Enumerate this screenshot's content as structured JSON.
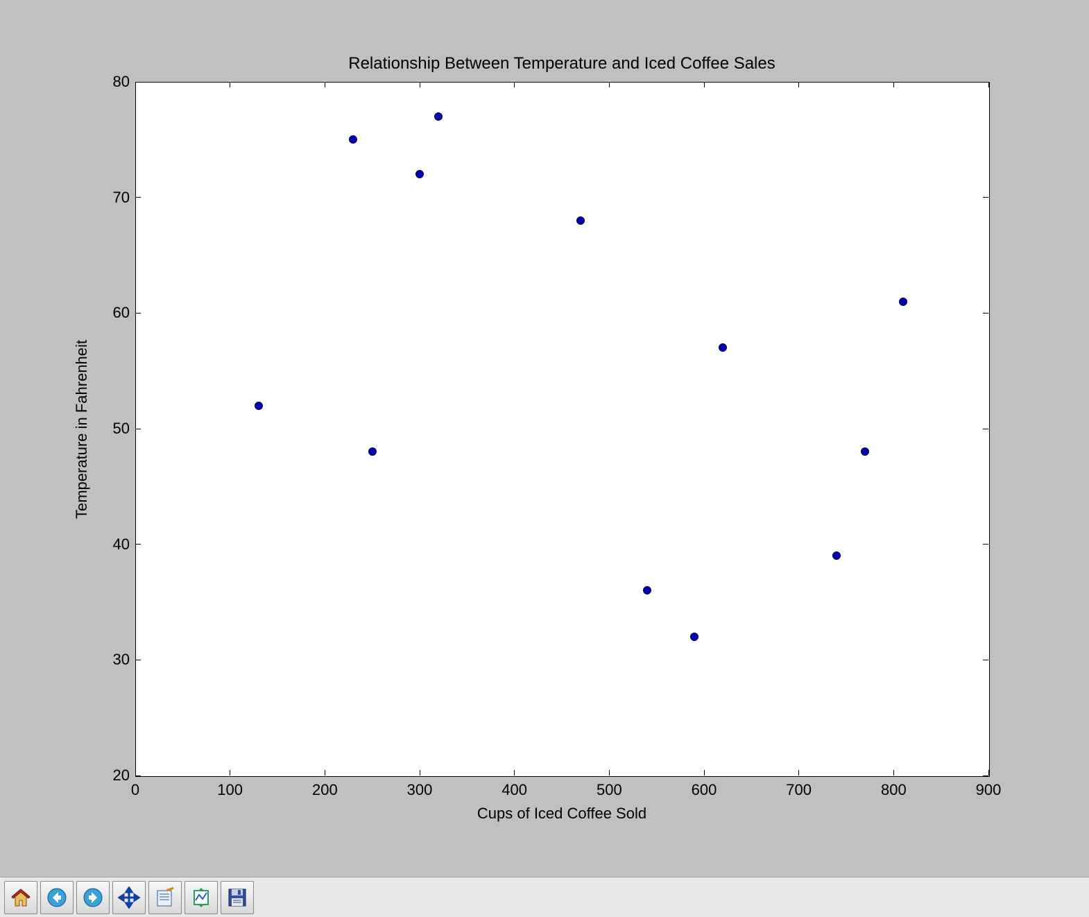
{
  "chart_data": {
    "type": "scatter",
    "title": "Relationship Between Temperature and Iced Coffee Sales",
    "xlabel": "Cups of Iced Coffee Sold",
    "ylabel": "Temperature in Fahrenheit",
    "xlim": [
      0,
      900
    ],
    "ylim": [
      20,
      80
    ],
    "xticks": [
      0,
      100,
      200,
      300,
      400,
      500,
      600,
      700,
      800,
      900
    ],
    "yticks": [
      20,
      30,
      40,
      50,
      60,
      70,
      80
    ],
    "points": [
      {
        "x": 130,
        "y": 52
      },
      {
        "x": 230,
        "y": 75
      },
      {
        "x": 250,
        "y": 48
      },
      {
        "x": 300,
        "y": 72
      },
      {
        "x": 320,
        "y": 77
      },
      {
        "x": 470,
        "y": 68
      },
      {
        "x": 540,
        "y": 36
      },
      {
        "x": 590,
        "y": 32
      },
      {
        "x": 620,
        "y": 57
      },
      {
        "x": 740,
        "y": 39
      },
      {
        "x": 770,
        "y": 48
      },
      {
        "x": 810,
        "y": 61
      }
    ]
  },
  "toolbar": {
    "home": "Home",
    "back": "Back",
    "forward": "Forward",
    "pan": "Pan",
    "zoom": "Zoom",
    "subplots": "Configure subplots",
    "save": "Save"
  }
}
